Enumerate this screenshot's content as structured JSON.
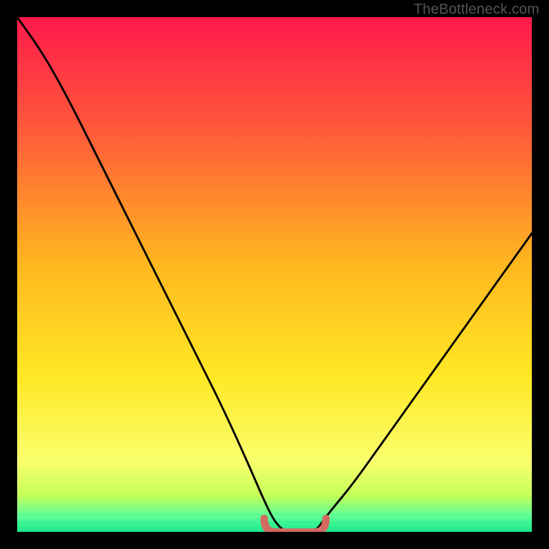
{
  "watermark": "TheBottleneck.com",
  "colors": {
    "frame": "#000000",
    "gradient_top": "#ff1a4b",
    "gradient_mid1": "#ff5a3a",
    "gradient_mid2": "#ffb71f",
    "gradient_mid3": "#ffe825",
    "gradient_mid4": "#fbff6d",
    "gradient_bottom_band1": "#c4ff5a",
    "gradient_bottom_band2": "#5cff98",
    "gradient_bottom_band3": "#18e88c",
    "curve": "#000000",
    "flat_segment": "#d46a60"
  },
  "chart_data": {
    "type": "line",
    "title": "",
    "xlabel": "",
    "ylabel": "",
    "xlim": [
      0,
      100
    ],
    "ylim": [
      0,
      100
    ],
    "series": [
      {
        "name": "bottleneck-curve",
        "x": [
          0,
          5,
          10,
          15,
          20,
          25,
          30,
          35,
          40,
          45,
          48,
          50,
          52,
          55,
          58,
          60,
          65,
          70,
          75,
          80,
          85,
          90,
          95,
          100
        ],
        "y": [
          100,
          93,
          84,
          74,
          64,
          54,
          44,
          34,
          24,
          13,
          6,
          2,
          0,
          0,
          0,
          3,
          9,
          16,
          23,
          30,
          37,
          44,
          51,
          58
        ]
      }
    ],
    "annotations": [
      {
        "name": "flat-bottom-segment",
        "x_start": 48,
        "x_end": 60,
        "y": 1
      }
    ]
  }
}
